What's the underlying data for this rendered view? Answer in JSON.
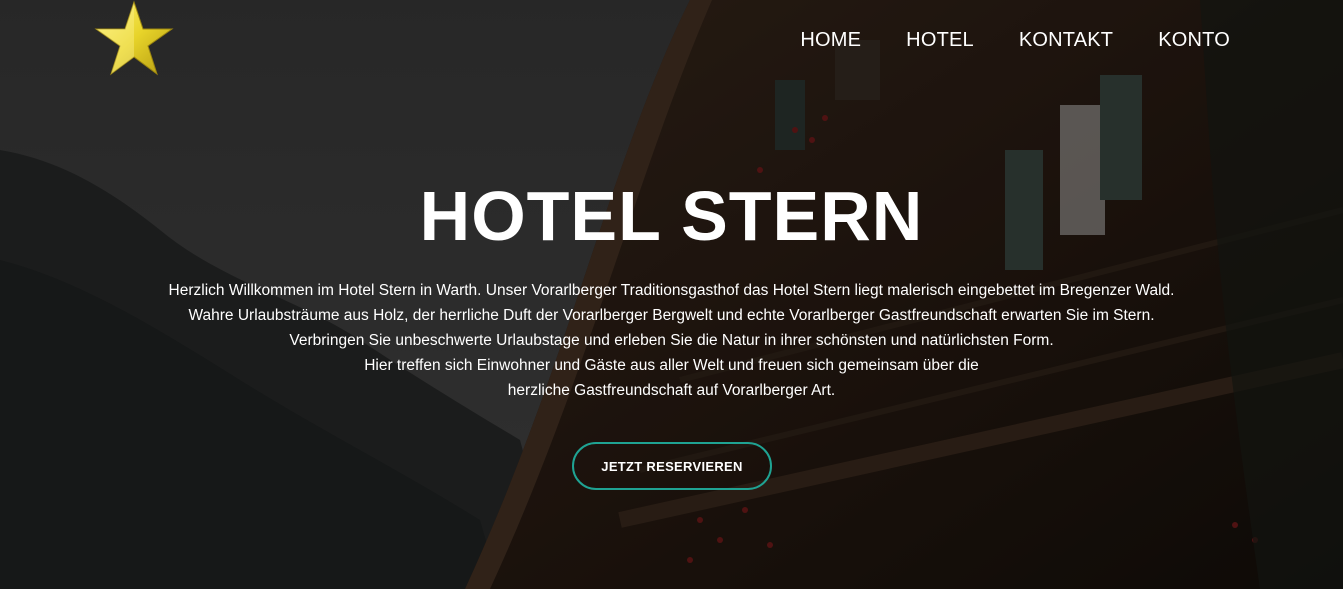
{
  "brand": {
    "logo_icon": "star-icon",
    "logo_color": "#e8d42a"
  },
  "nav": {
    "items": [
      {
        "label": "HOME"
      },
      {
        "label": "HOTEL"
      },
      {
        "label": "KONTAKT"
      },
      {
        "label": "KONTO"
      }
    ]
  },
  "hero": {
    "title": "HOTEL STERN",
    "intro_lines": [
      "Herzlich Willkommen im Hotel Stern in Warth. Unser Vorarlberger Traditionsgasthof das Hotel Stern liegt malerisch eingebettet im Bregenzer Wald.",
      "Wahre Urlaubsträume aus Holz, der herrliche Duft der Vorarlberger Bergwelt und echte Vorarlberger Gastfreundschaft erwarten Sie im Stern.",
      "Verbringen Sie unbeschwerte Urlaubstage und erleben Sie die Natur in ihrer schönsten und natürlichsten Form.",
      "Hier treffen sich Einwohner und Gäste aus aller Welt und freuen sich gemeinsam über die",
      "herzliche Gastfreundschaft auf Vorarlberger Art."
    ],
    "cta_label": "JETZT RESERVIEREN"
  },
  "colors": {
    "accent": "#1fa393",
    "text": "#ffffff"
  }
}
